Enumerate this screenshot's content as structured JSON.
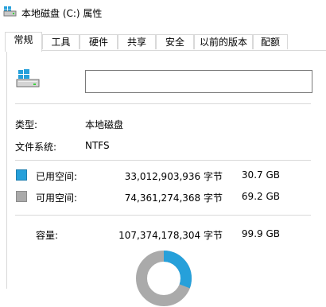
{
  "window": {
    "title": "本地磁盘 (C:) 属性"
  },
  "tabs": [
    {
      "label": "常规",
      "active": true
    },
    {
      "label": "工具",
      "active": false
    },
    {
      "label": "硬件",
      "active": false
    },
    {
      "label": "共享",
      "active": false
    },
    {
      "label": "安全",
      "active": false
    },
    {
      "label": "以前的版本",
      "active": false
    },
    {
      "label": "配额",
      "active": false
    }
  ],
  "general": {
    "drive_name_value": "",
    "type_label": "类型:",
    "type_value": "本地磁盘",
    "fs_label": "文件系统:",
    "fs_value": "NTFS",
    "used": {
      "label": "已用空间:",
      "bytes": "33,012,903,936 字节",
      "size": "30.7 GB"
    },
    "free": {
      "label": "可用空间:",
      "bytes": "74,361,274,368 字节",
      "size": "69.2 GB"
    },
    "capacity": {
      "label": "容量:",
      "bytes": "107,374,178,304 字节",
      "size": "99.9 GB"
    }
  },
  "colors": {
    "used": "#26a0da",
    "free": "#aaaaaa"
  },
  "usage": {
    "used_fraction": 0.307
  }
}
